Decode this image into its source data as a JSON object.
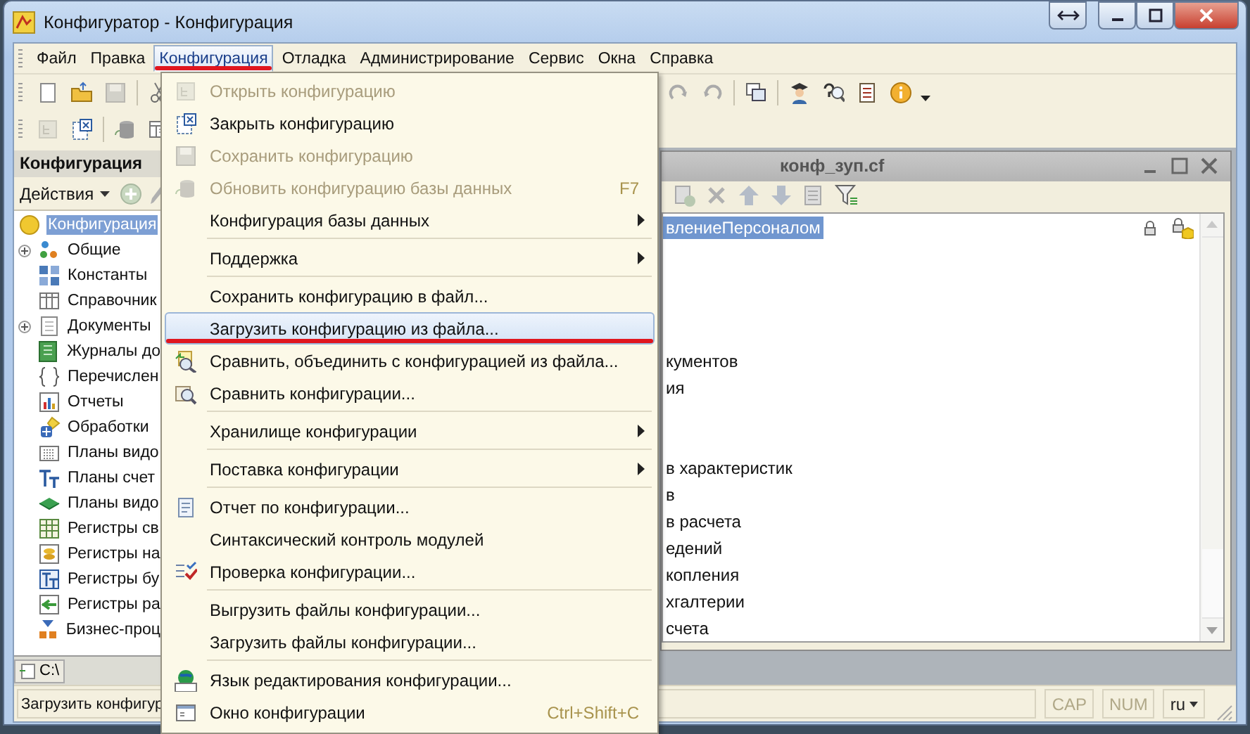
{
  "window": {
    "title": "Конфигуратор - Конфигурация"
  },
  "menu_bar": [
    {
      "label": "Файл",
      "selected": false
    },
    {
      "label": "Правка",
      "selected": false
    },
    {
      "label": "Конфигурация",
      "selected": true,
      "underlined": true
    },
    {
      "label": "Отладка",
      "selected": false
    },
    {
      "label": "Администрирование",
      "selected": false
    },
    {
      "label": "Сервис",
      "selected": false
    },
    {
      "label": "Окна",
      "selected": false
    },
    {
      "label": "Справка",
      "selected": false
    }
  ],
  "config_panel": {
    "title": "Конфигурация",
    "actions_label": "Действия",
    "tree": [
      {
        "label": "Конфигурация",
        "selected": true,
        "children": [
          {
            "label": "Общие",
            "expanded": false
          },
          {
            "label": "Константы"
          },
          {
            "label": "Справочник"
          },
          {
            "label": "Документы",
            "expanded": false
          },
          {
            "label": "Журналы до"
          },
          {
            "label": "Перечислен"
          },
          {
            "label": "Отчеты"
          },
          {
            "label": "Обработки"
          },
          {
            "label": "Планы видо"
          },
          {
            "label": "Планы счет"
          },
          {
            "label": "Планы видо"
          },
          {
            "label": "Регистры св"
          },
          {
            "label": "Регистры на"
          },
          {
            "label": "Регистры бу"
          },
          {
            "label": "Регистры ра"
          },
          {
            "label": "Бизнес-проц"
          }
        ]
      }
    ]
  },
  "panel_tab": {
    "label": "C:\\"
  },
  "document_window": {
    "title": "конф_зуп.cf",
    "rows": [
      {
        "kind": "item",
        "text": "влениеПерсоналом",
        "selected": true,
        "locked": true
      },
      {
        "kind": "blank"
      },
      {
        "kind": "blank"
      },
      {
        "kind": "blank"
      },
      {
        "kind": "blank"
      },
      {
        "kind": "item",
        "text": "кументов",
        "selected": false
      },
      {
        "kind": "item",
        "text": "ия",
        "selected": false
      },
      {
        "kind": "blank"
      },
      {
        "kind": "blank"
      },
      {
        "kind": "item",
        "text": "в характеристик",
        "selected": false
      },
      {
        "kind": "item",
        "text": "в",
        "selected": false
      },
      {
        "kind": "item",
        "text": "в расчета",
        "selected": false
      },
      {
        "kind": "item",
        "text": "едений",
        "selected": false
      },
      {
        "kind": "item",
        "text": "копления",
        "selected": false
      },
      {
        "kind": "item",
        "text": "хгалтерии",
        "selected": false
      },
      {
        "kind": "item",
        "text": "счета",
        "selected": false
      }
    ]
  },
  "dropdown_menu": [
    {
      "kind": "item",
      "label": "Открыть конфигурацию",
      "disabled": true,
      "selected": false
    },
    {
      "kind": "item",
      "label": "Закрыть конфигурацию",
      "disabled": false,
      "selected": false
    },
    {
      "kind": "item",
      "label": "Сохранить конфигурацию",
      "disabled": true,
      "selected": false
    },
    {
      "kind": "item",
      "label": "Обновить конфигурацию базы данных",
      "disabled": true,
      "selected": false,
      "shortcut": "F7"
    },
    {
      "kind": "item",
      "label": "Конфигурация базы данных",
      "disabled": false,
      "selected": false,
      "submenu": true
    },
    {
      "kind": "separator"
    },
    {
      "kind": "item",
      "label": "Поддержка",
      "disabled": false,
      "selected": false,
      "submenu": true
    },
    {
      "kind": "separator"
    },
    {
      "kind": "item",
      "label": "Сохранить конфигурацию в файл...",
      "disabled": false,
      "selected": false
    },
    {
      "kind": "item",
      "label": "Загрузить конфигурацию из файла...",
      "disabled": false,
      "selected": true,
      "underlined": true
    },
    {
      "kind": "item",
      "label": "Сравнить, объединить с конфигурацией из файла...",
      "disabled": false,
      "selected": false
    },
    {
      "kind": "item",
      "label": "Сравнить конфигурации...",
      "disabled": false,
      "selected": false
    },
    {
      "kind": "separator"
    },
    {
      "kind": "item",
      "label": "Хранилище конфигурации",
      "disabled": false,
      "selected": false,
      "submenu": true
    },
    {
      "kind": "separator"
    },
    {
      "kind": "item",
      "label": "Поставка конфигурации",
      "disabled": false,
      "selected": false,
      "submenu": true
    },
    {
      "kind": "separator"
    },
    {
      "kind": "item",
      "label": "Отчет по конфигурации...",
      "disabled": false,
      "selected": false
    },
    {
      "kind": "item",
      "label": "Синтаксический контроль модулей",
      "disabled": false,
      "selected": false
    },
    {
      "kind": "item",
      "label": "Проверка конфигурации...",
      "disabled": false,
      "selected": false
    },
    {
      "kind": "separator"
    },
    {
      "kind": "item",
      "label": "Выгрузить файлы конфигурации...",
      "disabled": false,
      "selected": false
    },
    {
      "kind": "item",
      "label": "Загрузить файлы конфигурации...",
      "disabled": false,
      "selected": false
    },
    {
      "kind": "separator"
    },
    {
      "kind": "item",
      "label": "Язык редактирования конфигурации...",
      "disabled": false,
      "selected": false
    },
    {
      "kind": "item",
      "label": "Окно конфигурации",
      "disabled": false,
      "selected": false,
      "shortcut": "Ctrl+Shift+C"
    }
  ],
  "status_bar": {
    "message": "Загрузить конфигур",
    "indicators": [
      "CAP",
      "NUM"
    ],
    "language": "ru"
  }
}
